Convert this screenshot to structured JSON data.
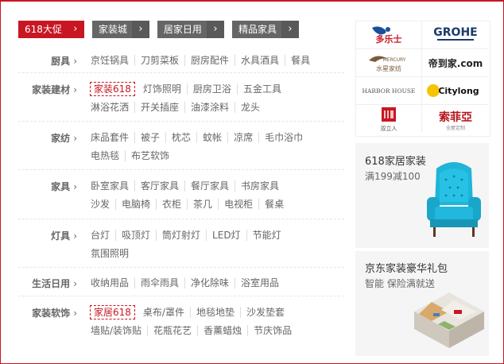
{
  "tabs": [
    {
      "label": "618大促",
      "active": true
    },
    {
      "label": "家装城",
      "active": false
    },
    {
      "label": "居家日用",
      "active": false
    },
    {
      "label": "精品家具",
      "active": false
    }
  ],
  "categories": [
    {
      "name": "厨具",
      "rows": [
        [
          "京饪锅具",
          "刀剪菜板",
          "厨房配件",
          "水具酒具",
          "餐具"
        ]
      ]
    },
    {
      "name": "家装建材",
      "rows": [
        [
          "家装618",
          "灯饰照明",
          "厨房卫浴",
          "五金工具"
        ],
        [
          "淋浴花洒",
          "开关插座",
          "油漆涂料",
          "龙头"
        ]
      ],
      "highlight": "家装618"
    },
    {
      "name": "家纺",
      "rows": [
        [
          "床品套件",
          "被子",
          "枕芯",
          "蚊帐",
          "凉席",
          "毛巾浴巾"
        ],
        [
          "电热毯",
          "布艺软饰"
        ]
      ]
    },
    {
      "name": "家具",
      "rows": [
        [
          "卧室家具",
          "客厅家具",
          "餐厅家具",
          "书房家具"
        ],
        [
          "沙发",
          "电脑椅",
          "衣柜",
          "茶几",
          "电视柜",
          "餐桌"
        ]
      ]
    },
    {
      "name": "灯具",
      "rows": [
        [
          "台灯",
          "吸顶灯",
          "筒灯射灯",
          "LED灯",
          "节能灯"
        ],
        [
          "氛围照明"
        ]
      ]
    },
    {
      "name": "生活日用",
      "rows": [
        [
          "收纳用品",
          "雨伞雨具",
          "净化除味",
          "浴室用品"
        ]
      ]
    },
    {
      "name": "家装软饰",
      "rows": [
        [
          "家居618",
          "桌布/罩件",
          "地毯地垫",
          "沙发垫套"
        ],
        [
          "墙贴/装饰贴",
          "花瓶花艺",
          "香薰蜡烛",
          "节庆饰品"
        ]
      ],
      "highlight": "家居618"
    }
  ],
  "brands": [
    "多乐士",
    "GROHE",
    "水星家纺",
    "帝到家.com",
    "HARBOR HOUSE",
    "Citylong",
    "双立人",
    "索菲亞"
  ],
  "brand_subs": {
    "mercury": "MERCURY",
    "sofia": "全屋定制"
  },
  "promos": [
    {
      "title": "618家居家装",
      "subtitle": "满199减100"
    },
    {
      "title": "京东家装豪华礼包",
      "subtitle": "智能 保险满就送"
    }
  ],
  "colors": {
    "brand_red": "#c81623",
    "tab_gray": "#666666",
    "chair_blue": "#1fb4d8"
  }
}
